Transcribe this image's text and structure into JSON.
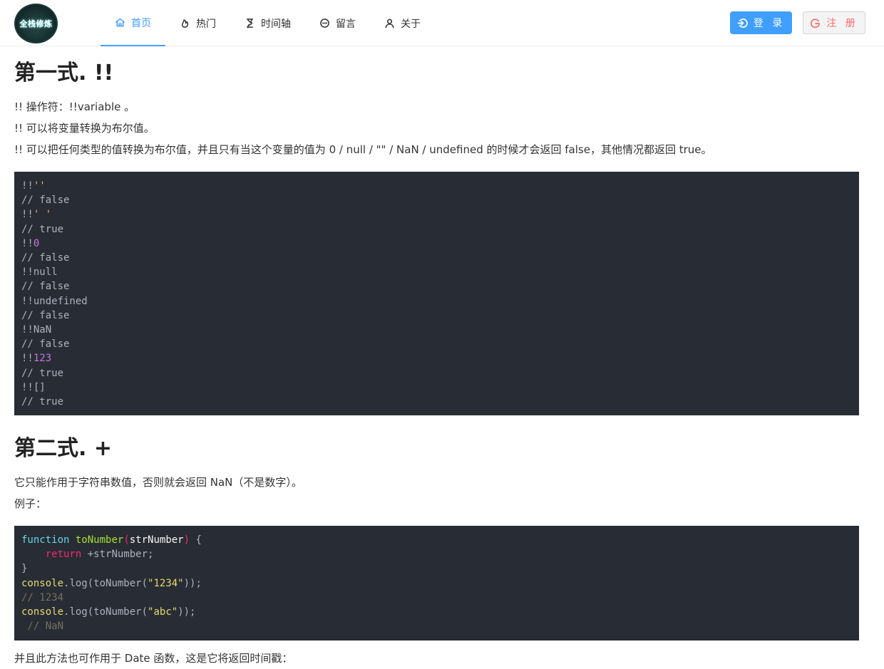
{
  "header": {
    "logo_text": "全栈修炼",
    "nav": [
      {
        "label": "首页",
        "icon": "home-icon",
        "active": true
      },
      {
        "label": "热门",
        "icon": "flame-icon",
        "active": false
      },
      {
        "label": "时间轴",
        "icon": "hourglass-icon",
        "active": false
      },
      {
        "label": "留言",
        "icon": "chat-icon",
        "active": false
      },
      {
        "label": "关于",
        "icon": "user-icon",
        "active": false
      }
    ],
    "login_label": "登 录",
    "register_label": "注 册"
  },
  "colors": {
    "primary": "#409eff",
    "danger": "#f56c6c",
    "code_bg": "#282c34"
  },
  "section1": {
    "title": "第一式. !!",
    "paragraphs": [
      "!! 操作符：!!variable 。",
      "!! 可以将变量转换为布尔值。",
      "!! 可以把任何类型的值转换为布尔值，并且只有当这个变量的值为 0 / null / \"\" / NaN / undefined 的时候才会返回 false，其他情况都返回 true。"
    ],
    "code": [
      {
        "a": "!!",
        "b": "''",
        "t": "str"
      },
      {
        "a": "// false"
      },
      {
        "a": "!!",
        "b": "' '",
        "t": "str"
      },
      {
        "a": "// true"
      },
      {
        "a": "!!",
        "b": "0",
        "t": "num"
      },
      {
        "a": "// false"
      },
      {
        "a": "!!null"
      },
      {
        "a": "// false"
      },
      {
        "a": "!!undefined"
      },
      {
        "a": "// false"
      },
      {
        "a": "!!NaN"
      },
      {
        "a": "// false"
      },
      {
        "a": "!!",
        "b": "123",
        "t": "num"
      },
      {
        "a": "// true"
      },
      {
        "a": "!![]"
      },
      {
        "a": "// true"
      }
    ]
  },
  "section2": {
    "title": "第二式. +",
    "paragraphs": [
      "它只能作用于字符串数值，否则就会返回 NaN（不是数字）。",
      "例子："
    ],
    "code": {
      "l1_kw": "function",
      "l1_fn": "toNumber",
      "l1_open": "(",
      "l1_param": "strNumber",
      "l1_close": ")",
      "l1_brace": " {",
      "l2_ret": "return",
      "l2_rest": " +strNumber;",
      "l3": "}",
      "l4_obj": "console",
      "l4_mid": ".log(toNumber(",
      "l4_str": "\"1234\"",
      "l4_end": "));",
      "l5": "// 1234",
      "l6_obj": "console",
      "l6_mid": ".log(toNumber(",
      "l6_str": "\"abc\"",
      "l6_end": "));",
      "l7": " // NaN"
    },
    "after": "并且此方法也可作用于 Date 函数，这是它将返回时间戳："
  }
}
